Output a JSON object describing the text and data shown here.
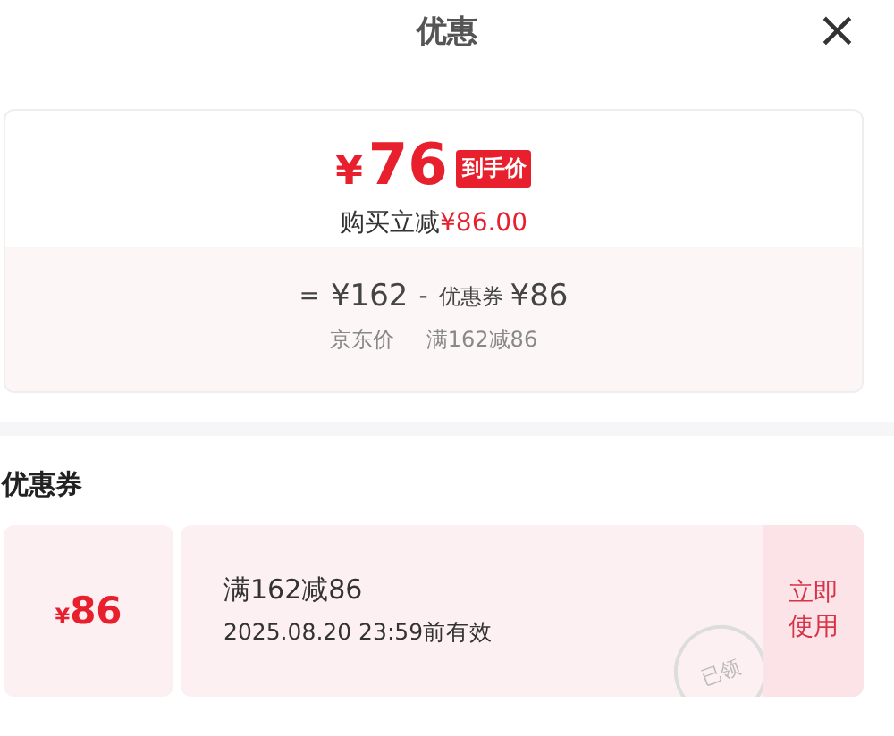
{
  "header": {
    "title": "优惠",
    "close": "×"
  },
  "summary": {
    "price_symbol": "¥",
    "price": "76",
    "badge": "到手价",
    "saving_label": "购买立减",
    "saving_amount": "¥86.00",
    "formula": [
      {
        "kind": "op",
        "text": "="
      },
      {
        "kind": "amount",
        "text": "¥162"
      },
      {
        "kind": "op",
        "text": "-"
      },
      {
        "kind": "label",
        "text": "优惠券"
      },
      {
        "kind": "amount",
        "text": "¥86"
      }
    ],
    "notes": [
      "京东价",
      "满162减86"
    ]
  },
  "coupons_section": {
    "title": "优惠券",
    "coupons": [
      {
        "currency": "¥",
        "amount": "86",
        "condition": "满162减86",
        "validity": "2025.08.20 23:59前有效",
        "stamp": "已领",
        "action": "立即使用"
      }
    ]
  }
}
